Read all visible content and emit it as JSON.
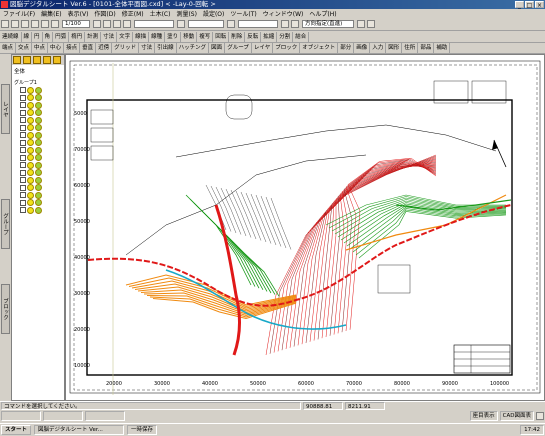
{
  "window": {
    "title": "図脳デジタルシート Ver.6 - [0101-全体平面図.cxd] < -Lay-0-回転 >"
  },
  "menu": [
    "ファイル(F)",
    "編集(E)",
    "表示(V)",
    "作図(D)",
    "修正(M)",
    "土木(C)",
    "測量(S)",
    "設定(O)",
    "ツール(T)",
    "ウィンドウ(W)",
    "ヘルプ(H)"
  ],
  "toolbar1": {
    "scale": "1/100",
    "right_combo": "方向指定(直進)"
  },
  "commands_row2": [
    "連続線",
    "線",
    "円",
    "角",
    "円弧",
    "楕円",
    "計測",
    "寸法",
    "文字",
    "線描",
    "線種",
    "塗り",
    "移動",
    "複写",
    "回転",
    "削除",
    "反転",
    "拡縮",
    "分割",
    "結合"
  ],
  "commands_row3": [
    "端点",
    "交点",
    "中点",
    "中心",
    "接点",
    "垂直",
    "近傍",
    "グリッド",
    "寸法",
    "引出線",
    "ハッチング",
    "図面",
    "グループ",
    "レイヤ",
    "ブロック",
    "オブジェクト",
    "部分",
    "画像",
    "入力",
    "図形",
    "住所",
    "部品",
    "補助"
  ],
  "panel": {
    "title": "全体",
    "group_label": "グループ1",
    "layer_count": 17
  },
  "side_tabs": [
    "レイヤ",
    "グループ",
    "ブロック"
  ],
  "status": {
    "message": "コマンドを選択してください。"
  },
  "coords": {
    "x": "90888.81",
    "y": "8211.91"
  },
  "coord_buttons": [
    "座目表示",
    "CAD図面表"
  ],
  "taskbar": {
    "start": "スタート",
    "app": "図脳デジタルシート Ver...",
    "other": "一時保存",
    "clock": "17:42"
  },
  "y_ticks": [
    "5000",
    "70000",
    "60000",
    "50000",
    "40000",
    "30000",
    "20000",
    "10000"
  ],
  "x_ticks": [
    "20000",
    "30000",
    "40000",
    "50000",
    "60000",
    "70000",
    "80000",
    "90000",
    "100000"
  ],
  "colors": {
    "red": "#e01818",
    "green": "#1a9a1a",
    "orange": "#f08a10",
    "cyan": "#18a8c8",
    "dark": "#101010"
  }
}
